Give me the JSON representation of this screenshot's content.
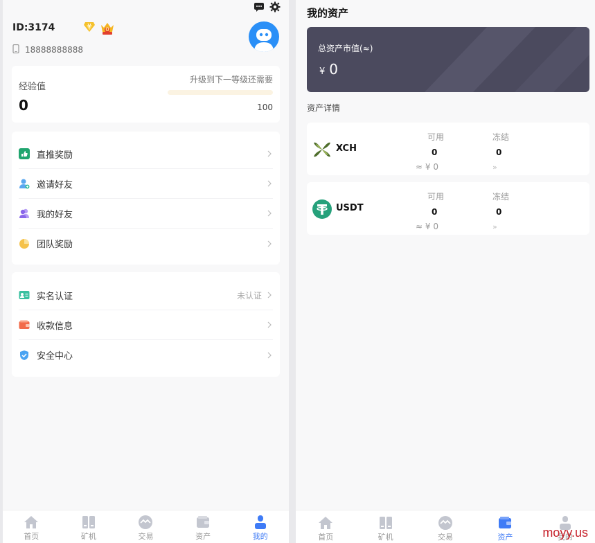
{
  "profile": {
    "uid": "ID:3174",
    "phone": "18888888888",
    "badge_level": "0"
  },
  "experience": {
    "label": "经验值",
    "value": "0",
    "hint": "升级到下一等级还需要",
    "max": "100",
    "progress_percent": 0
  },
  "menu_group_1": [
    {
      "label": "直推奖励",
      "icon": "thumbs-up-icon"
    },
    {
      "label": "邀请好友",
      "icon": "user-add-icon"
    },
    {
      "label": "我的好友",
      "icon": "friends-icon"
    },
    {
      "label": "团队奖励",
      "icon": "pie-chart-icon"
    }
  ],
  "menu_group_2": [
    {
      "label": "实名认证",
      "icon": "id-card-icon",
      "status": "未认证"
    },
    {
      "label": "收款信息",
      "icon": "wallet-icon"
    },
    {
      "label": "安全中心",
      "icon": "shield-icon"
    }
  ],
  "tabs_left": [
    {
      "label": "首页",
      "icon": "home-icon",
      "active": false
    },
    {
      "label": "矿机",
      "icon": "miner-icon",
      "active": false
    },
    {
      "label": "交易",
      "icon": "exchange-icon",
      "active": false
    },
    {
      "label": "资产",
      "icon": "wallet-icon",
      "active": false
    },
    {
      "label": "我的",
      "icon": "user-icon",
      "active": true
    }
  ],
  "assets_page": {
    "title": "我的资产",
    "total_label": "总资产市值(≈)",
    "currency": "¥",
    "total_value": "0",
    "section_label": "资产详情",
    "available_header": "可用",
    "frozen_header": "冻结",
    "coins": [
      {
        "name": "XCH",
        "available": "0",
        "frozen": "0",
        "cny": "≈ ¥ 0",
        "icon": "chia-icon"
      },
      {
        "name": "USDT",
        "available": "0",
        "frozen": "0",
        "cny": "≈ ¥ 0",
        "icon": "tether-icon"
      }
    ]
  },
  "tabs_right": [
    {
      "label": "首页",
      "icon": "home-icon",
      "active": false
    },
    {
      "label": "矿机",
      "icon": "miner-icon",
      "active": false
    },
    {
      "label": "交易",
      "icon": "exchange-icon",
      "active": false
    },
    {
      "label": "资产",
      "icon": "wallet-icon",
      "active": true
    },
    {
      "label": "我的",
      "icon": "user-icon",
      "active": false
    }
  ],
  "watermark": "moyy.us",
  "colors": {
    "accent": "#3f7bf6",
    "card_dark": "#4b4a5e",
    "avatar": "#2a8ff7",
    "tether": "#26a17b"
  }
}
